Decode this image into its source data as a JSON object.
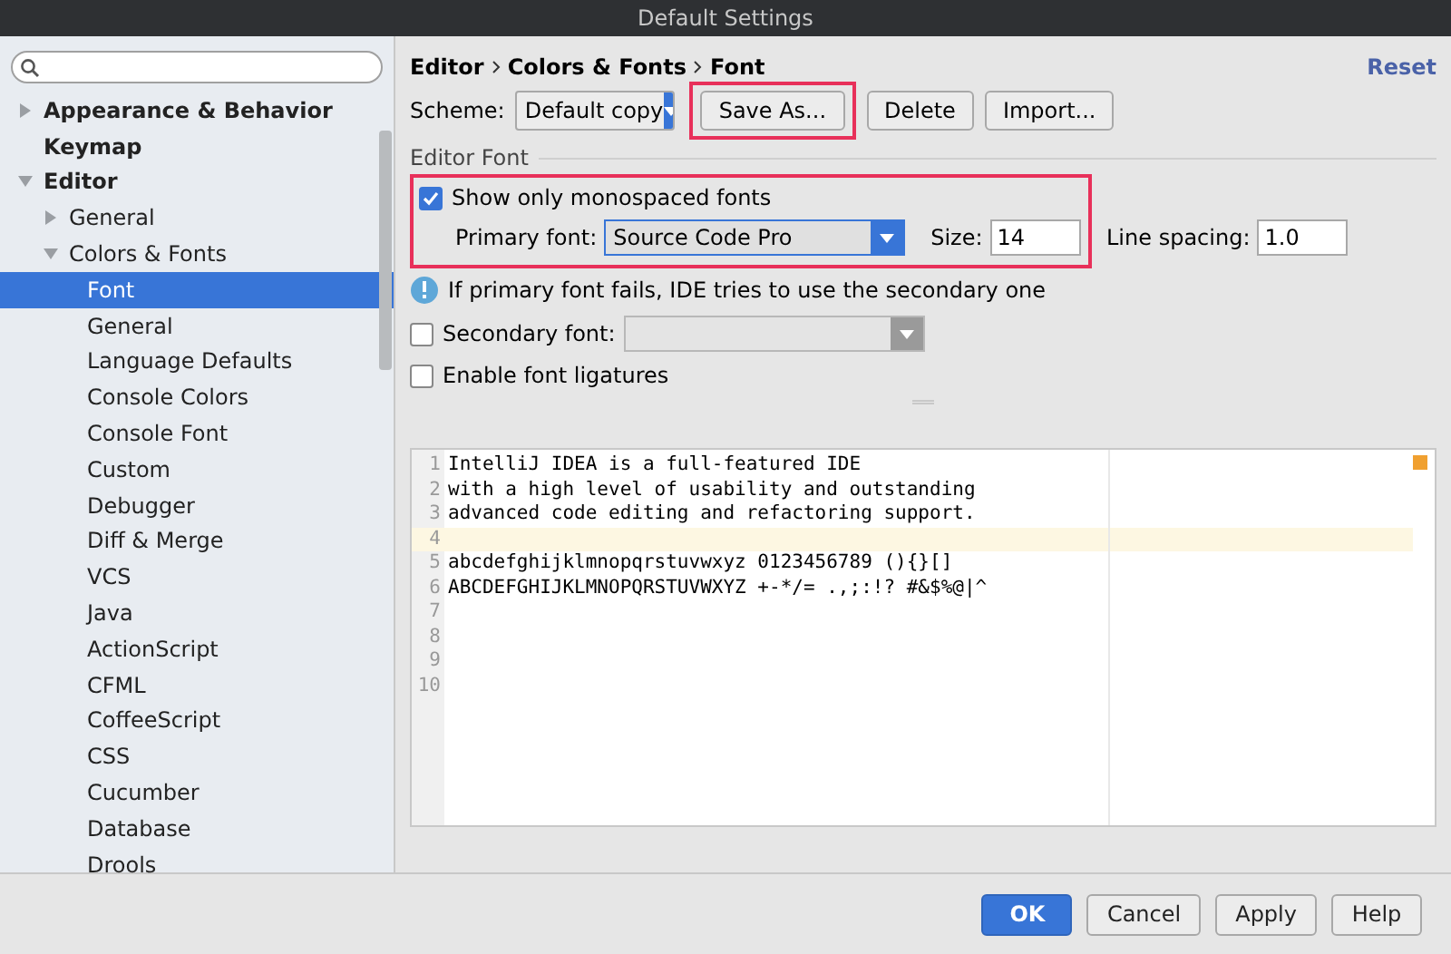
{
  "window": {
    "title": "Default Settings"
  },
  "sidebar": {
    "items": [
      {
        "label": "Appearance & Behavior",
        "expanded": false,
        "selected": false
      },
      {
        "label": "Keymap",
        "selected": false
      },
      {
        "label": "Editor",
        "expanded": true,
        "selected": false,
        "children": [
          {
            "label": "General",
            "expanded": false,
            "selected": false
          },
          {
            "label": "Colors & Fonts",
            "expanded": true,
            "selected": false,
            "children": [
              {
                "label": "Font",
                "selected": true
              },
              {
                "label": "General",
                "selected": false
              },
              {
                "label": "Language Defaults",
                "selected": false
              },
              {
                "label": "Console Colors",
                "selected": false
              },
              {
                "label": "Console Font",
                "selected": false
              },
              {
                "label": "Custom",
                "selected": false
              },
              {
                "label": "Debugger",
                "selected": false
              },
              {
                "label": "Diff & Merge",
                "selected": false
              },
              {
                "label": "VCS",
                "selected": false
              },
              {
                "label": "Java",
                "selected": false
              },
              {
                "label": "ActionScript",
                "selected": false
              },
              {
                "label": "CFML",
                "selected": false
              },
              {
                "label": "CoffeeScript",
                "selected": false
              },
              {
                "label": "CSS",
                "selected": false
              },
              {
                "label": "Cucumber",
                "selected": false
              },
              {
                "label": "Database",
                "selected": false
              },
              {
                "label": "Drools",
                "selected": false
              }
            ]
          }
        ]
      }
    ]
  },
  "breadcrumb": [
    "Editor",
    "Colors & Fonts",
    "Font"
  ],
  "reset": "Reset",
  "scheme": {
    "label": "Scheme:",
    "value": "Default copy",
    "buttons": [
      {
        "label": "Save As...",
        "highlighted": true
      },
      {
        "label": "Delete",
        "highlighted": false
      },
      {
        "label": "Import...",
        "highlighted": false
      }
    ]
  },
  "editor_font": {
    "title": "Editor Font",
    "highlighted": true,
    "monospaced": {
      "label": "Show only monospaced fonts",
      "checked": true
    },
    "primary_font": {
      "label": "Primary font:",
      "value": "Source Code Pro"
    },
    "size": {
      "label": "Size:",
      "value": "14"
    },
    "line_spacing": {
      "label": "Line spacing:",
      "value": "1.0"
    },
    "info": "If primary font fails, IDE tries to use the secondary one",
    "secondary_font": {
      "label": "Secondary font:",
      "checked": false,
      "disabled": true
    },
    "ligatures": {
      "label": "Enable font ligatures",
      "checked": false
    }
  },
  "preview": {
    "lines": [
      {
        "number": "1",
        "text": "IntelliJ IDEA is a full-featured IDE",
        "current": false
      },
      {
        "number": "2",
        "text": "with a high level of usability and outstanding",
        "current": false
      },
      {
        "number": "3",
        "text": "advanced code editing and refactoring support.",
        "current": false
      },
      {
        "number": "4",
        "current": true
      },
      {
        "number": "5",
        "text": "abcdefghijklmnopqrstuvwxyz 0123456789 (){}[]",
        "current": false
      },
      {
        "number": "6",
        "text": "ABCDEFGHIJKLMNOPQRSTUVWXYZ +-*/= .,;:!? #&$%@|^",
        "current": false
      },
      {
        "number": "7",
        "current": false
      },
      {
        "number": "8",
        "current": false
      },
      {
        "number": "9",
        "current": false
      },
      {
        "number": "10",
        "current": false
      }
    ]
  },
  "footer": [
    {
      "label": "OK",
      "default": true
    },
    {
      "label": "Cancel",
      "default": false
    },
    {
      "label": "Apply",
      "default": false
    },
    {
      "label": "Help",
      "default": false
    }
  ]
}
